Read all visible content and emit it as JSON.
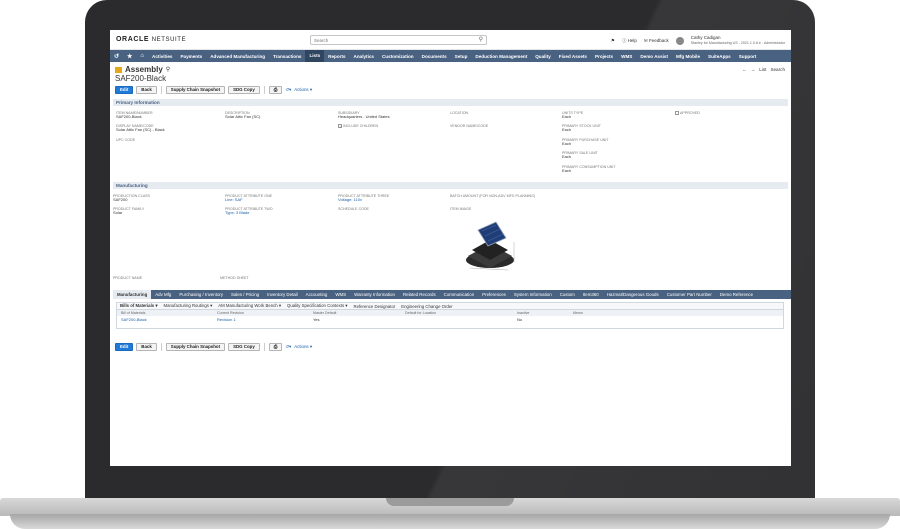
{
  "app": {
    "logo_main": "ORACLE",
    "logo_sub": "NETSUITE",
    "search_placeholder": "Search",
    "help": "Help",
    "feedback": "Feedback",
    "user_name": "Cathy Cadigan",
    "user_role": "Stanley for Manufacturing US - 2021.1.0.6.e - Administrator"
  },
  "nav": {
    "items": [
      "Activities",
      "Payments",
      "Advanced Manufacturing",
      "Transactions",
      "Lists",
      "Reports",
      "Analytics",
      "Customization",
      "Documents",
      "Setup",
      "Deduction Management",
      "Quality",
      "Fixed Assets",
      "Projects",
      "WMS",
      "Demo Assist",
      "Mfg Mobile",
      "SuiteApps",
      "Support"
    ],
    "active": "Lists"
  },
  "record": {
    "type": "Assembly",
    "name": "SAF200-Black",
    "list_link": "List",
    "search_link": "Search"
  },
  "buttons": {
    "edit": "Edit",
    "back": "Back",
    "supply_chain": "Supply Chain Snapshot",
    "sdg_copy": "SDG Copy",
    "actions": "Actions"
  },
  "primary": {
    "section_title": "Primary Information",
    "item_name_label": "Item Name/Number",
    "item_name": "SAF200-Black",
    "display_name_label": "Display Name/Code",
    "display_name": "Solar Attic Fan (SC) - Black",
    "upc_label": "UPC Code",
    "description_label": "Description",
    "description": "Solar Attic Fan (SC)",
    "subsidiary_label": "Subsidiary",
    "subsidiary": "Headquarters : United States",
    "include_children": "Include Children",
    "location_label": "Location",
    "vendor_label": "Vendor Name/Code",
    "units_type_label": "Units Type",
    "units_type": "Each",
    "primary_stock_label": "Primary Stock Unit",
    "primary_stock": "Each",
    "primary_purchase_label": "Primary Purchase Unit",
    "primary_purchase": "Each",
    "primary_sale_label": "Primary Sale Unit",
    "primary_sale": "Each",
    "primary_consumption_label": "Primary Consumption Unit",
    "primary_consumption": "Each",
    "approved": "Approved"
  },
  "manufacturing": {
    "section_title": "Manufacturing",
    "production_class_label": "Production Class",
    "production_class": "SAF200",
    "product_family_label": "Product Family",
    "product_family": "Solar",
    "attr_one_label": "Product Attribute One",
    "attr_one": "Line: SAF",
    "attr_two_label": "Product Attribute Two",
    "attr_two": "Type: 3 Blade",
    "attr_three_label": "Product Attribute Three",
    "attr_three": "Voltage: 110v",
    "schedule_code_label": "Schedule Code",
    "batch_label": "Batch Amount (for Non-ADV MFG Planning)",
    "item_image_label": "Item Image",
    "product_name_label": "Product Name",
    "method_sheet_label": "Method Sheet"
  },
  "subtabs": {
    "items": [
      "Manufacturing",
      "Adv Mfg",
      "Purchasing / Inventory",
      "Sales / Pricing",
      "Inventory Detail",
      "Accounting",
      "WMS",
      "Warranty Information",
      "Related Records",
      "Communication",
      "Preferences",
      "System Information",
      "Custom",
      "Item360",
      "Hazmat/Dangerous Goods",
      "Customer Part Number",
      "Demo Reference"
    ],
    "active": "Manufacturing"
  },
  "sublist": {
    "tabs": [
      "Bills of Materials",
      "Manufacturing Routings",
      "AM Manufacturing Work Bench",
      "Quality Specification Contexts",
      "Reference Designator",
      "Engineering Change Order"
    ],
    "headers": [
      "Bill of Materials",
      "Current Revision",
      "Master Default",
      "Default for Location",
      "Inactive",
      "Memo"
    ],
    "row": [
      "SAF200-Black",
      "Revision 1",
      "Yes",
      "",
      "No",
      ""
    ]
  },
  "colors": {
    "nav_bg": "#4a6282",
    "primary_button": "#1f7ad8",
    "link": "#1a5ea8"
  }
}
